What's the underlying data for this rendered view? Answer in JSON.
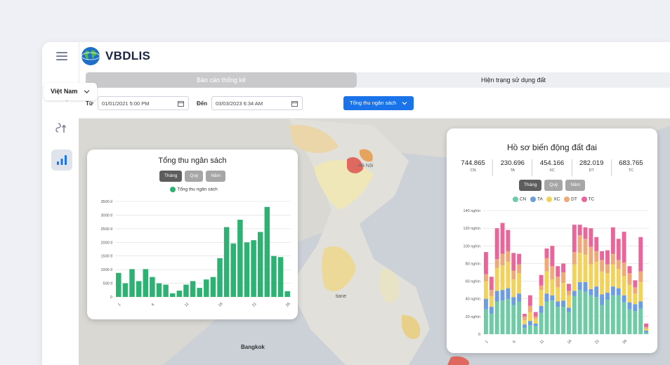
{
  "app": {
    "logo_text": "VBDLIS"
  },
  "tabs": [
    {
      "label": "Báo cáo thống kê"
    },
    {
      "label": "Hiện trạng sử dụng đất"
    }
  ],
  "filters": {
    "from_label": "Từ",
    "from_value": "01/01/2021 5:00 PM",
    "to_label": "Đến",
    "to_value": "03/03/2023 6:34 AM",
    "metric_label": "Tổng thu ngân sách"
  },
  "region_select": "Việt Nam",
  "map_labels": {
    "hanoi": "Hà Nội",
    "vientiane": "tiane",
    "bangkok": "Bangkok"
  },
  "revenue_card": {
    "title": "Tổng thu ngân sách",
    "periods": [
      "Tháng",
      "Quý",
      "Năm"
    ],
    "legend": "Tổng thu ngân sách"
  },
  "land_card": {
    "title": "Hồ sơ biến động đất đai",
    "stats": [
      {
        "value": "744.865",
        "key": "CN"
      },
      {
        "value": "230.696",
        "key": "TA"
      },
      {
        "value": "454.166",
        "key": "XC"
      },
      {
        "value": "282.019",
        "key": "DT"
      },
      {
        "value": "683.765",
        "key": "TC"
      }
    ],
    "periods": [
      "Tháng",
      "Quý",
      "Năm"
    ]
  },
  "colors": {
    "green": "#2db274",
    "cn": "#6fcaa6",
    "ta": "#6d9de0",
    "xc": "#f1d25a",
    "dt": "#efa978",
    "tc": "#e8669a",
    "accent": "#1a73e8"
  },
  "chart_data": [
    {
      "type": "bar",
      "ylim": [
        0,
        3500
      ],
      "yticks": [
        "0",
        "500 tỉ",
        "1000 tỉ",
        "1500 tỉ",
        "2000 tỉ",
        "2500 tỉ",
        "3000 tỉ",
        "3500 tỉ"
      ],
      "xticks": [
        "1",
        "6",
        "11",
        "16",
        "21",
        "26"
      ],
      "series": [
        {
          "name": "Tổng thu ngân sách",
          "values": [
            880,
            500,
            1020,
            580,
            1020,
            730,
            500,
            450,
            130,
            230,
            450,
            580,
            330,
            640,
            730,
            1420,
            2560,
            1960,
            2830,
            2000,
            2080,
            2380,
            3300,
            1500,
            1460,
            210
          ]
        }
      ]
    },
    {
      "type": "bar",
      "stacked": true,
      "ylim": [
        0,
        140000
      ],
      "yticks": [
        "0",
        "20 nghìn",
        "40 nghìn",
        "60 nghìn",
        "80 nghìn",
        "100 nghìn",
        "120 nghìn",
        "140 nghìn"
      ],
      "xticks": [
        "1",
        "6",
        "11",
        "16",
        "21",
        "26"
      ],
      "categories": [
        "1",
        "2",
        "3",
        "4",
        "5",
        "6",
        "7",
        "8",
        "9",
        "10",
        "11",
        "12",
        "13",
        "14",
        "15",
        "16",
        "17",
        "18",
        "19",
        "20",
        "21",
        "22",
        "23",
        "24",
        "25",
        "26",
        "27",
        "28",
        "29",
        "30"
      ],
      "series": [
        {
          "name": "CN",
          "values": [
            28000,
            23000,
            37000,
            38000,
            40000,
            33000,
            37000,
            7000,
            10000,
            9000,
            24000,
            37000,
            38000,
            31000,
            31000,
            25000,
            43000,
            50000,
            48000,
            44000,
            42000,
            33000,
            39000,
            44000,
            44000,
            36000,
            28000,
            26000,
            29000,
            2000
          ]
        },
        {
          "name": "TA",
          "values": [
            12000,
            8000,
            12000,
            12000,
            12000,
            9000,
            9000,
            4000,
            5000,
            3000,
            8000,
            9000,
            6000,
            6000,
            7000,
            5000,
            6000,
            9000,
            11000,
            7000,
            12000,
            12000,
            8000,
            10000,
            8000,
            8000,
            8000,
            8000,
            8000,
            2000
          ]
        },
        {
          "name": "XC",
          "values": [
            20000,
            12000,
            26000,
            28000,
            30000,
            20000,
            23000,
            5000,
            10000,
            5000,
            18000,
            25000,
            18000,
            16000,
            20000,
            14000,
            30000,
            33000,
            31000,
            28000,
            28000,
            26000,
            22000,
            25000,
            22000,
            22000,
            20000,
            12000,
            22000,
            2000
          ]
        },
        {
          "name": "DT",
          "values": [
            8000,
            7000,
            10000,
            13000,
            12000,
            10000,
            10000,
            4000,
            7000,
            3000,
            5000,
            15000,
            15000,
            12000,
            12000,
            5000,
            14000,
            20000,
            18000,
            20000,
            12000,
            13000,
            10000,
            12000,
            10000,
            15000,
            13000,
            7000,
            12000,
            2000
          ]
        },
        {
          "name": "TC",
          "values": [
            25000,
            15000,
            35000,
            35000,
            24000,
            20000,
            12000,
            3000,
            12000,
            5000,
            12000,
            11000,
            23000,
            12000,
            10000,
            8000,
            31000,
            12000,
            13000,
            21000,
            16000,
            10000,
            16000,
            30000,
            24000,
            35000,
            8000,
            8000,
            39000,
            4000
          ]
        }
      ]
    }
  ]
}
